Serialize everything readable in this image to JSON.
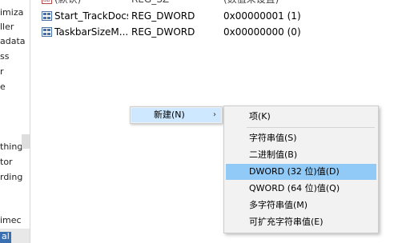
{
  "tree": {
    "items": [
      "imiza",
      "ller",
      "adata",
      "ss",
      "r",
      "e",
      "thing",
      "tor",
      "rding",
      "imec",
      "al"
    ]
  },
  "values": {
    "rows": [
      {
        "name": "(默认)",
        "type": "REG_SZ",
        "data": "(数值未设置)"
      },
      {
        "name": "Start_TrackDocs",
        "type": "REG_DWORD",
        "data": "0x00000001 (1)"
      },
      {
        "name": "TaskbarSizeM...",
        "type": "REG_DWORD",
        "data": "0x00000000 (0)"
      }
    ]
  },
  "context_menu": {
    "label": "新建(N)",
    "arrow": "›"
  },
  "submenu": {
    "items": [
      "项(K)",
      "字符串值(S)",
      "二进制值(B)",
      "DWORD (32 位)值(D)",
      "QWORD (64 位)值(Q)",
      "多字符串值(M)",
      "可扩充字符串值(E)"
    ],
    "highlighted_index": 3
  },
  "colors": {
    "menu_background": "#f0f0f0",
    "menu_hover": "#cde8ff",
    "submenu_highlight": "#91c9f7"
  }
}
